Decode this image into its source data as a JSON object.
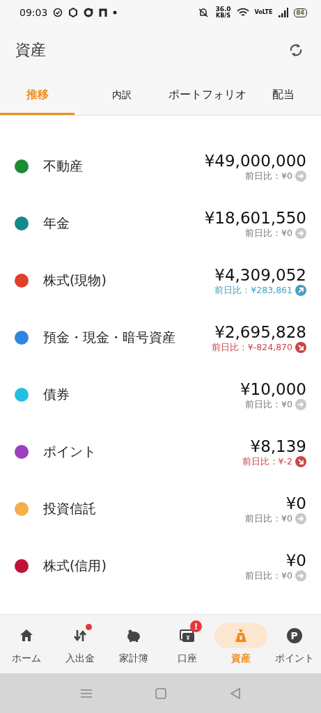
{
  "status_bar": {
    "time": "09:03",
    "speed": "36.0",
    "speed_unit": "KB/S",
    "network": "VoLTE",
    "battery": "84"
  },
  "app_bar": {
    "title": "資産"
  },
  "tabs": [
    {
      "label": "推移",
      "selected": true
    },
    {
      "label": "内訳",
      "selected": false
    },
    {
      "label": "ポートフォリオ",
      "selected": false
    },
    {
      "label": "配当",
      "selected": false
    }
  ],
  "assets": [
    {
      "name": "不動産",
      "color": "#1e8a32",
      "amount": "¥49,000,000",
      "change": "前日比：¥0",
      "kind": "flat"
    },
    {
      "name": "年金",
      "color": "#138a86",
      "amount": "¥18,601,550",
      "change": "前日比：¥0",
      "kind": "flat"
    },
    {
      "name": "株式(現物)",
      "color": "#e0402a",
      "amount": "¥4,309,052",
      "change": "前日比：¥283,861",
      "kind": "up"
    },
    {
      "name": "預金・現金・暗号資産",
      "color": "#2f86e0",
      "amount": "¥2,695,828",
      "change": "前日比：¥-824,870",
      "kind": "down"
    },
    {
      "name": "債券",
      "color": "#22c0dc",
      "amount": "¥10,000",
      "change": "前日比：¥0",
      "kind": "flat"
    },
    {
      "name": "ポイント",
      "color": "#9a3fc0",
      "amount": "¥8,139",
      "change": "前日比：¥-2",
      "kind": "down"
    },
    {
      "name": "投資信託",
      "color": "#f7ad4b",
      "amount": "¥0",
      "change": "前日比：¥0",
      "kind": "flat"
    },
    {
      "name": "株式(信用)",
      "color": "#c0103a",
      "amount": "¥0",
      "change": "前日比：¥0",
      "kind": "flat"
    }
  ],
  "bottom_nav": [
    {
      "label": "ホーム",
      "selected": false,
      "has_dot": false
    },
    {
      "label": "入出金",
      "selected": false,
      "has_dot": true
    },
    {
      "label": "家計簿",
      "selected": false,
      "has_dot": false
    },
    {
      "label": "口座",
      "selected": false,
      "has_dot": false,
      "badge_text": "!"
    },
    {
      "label": "資産",
      "selected": true,
      "has_dot": false
    },
    {
      "label": "ポイント",
      "selected": false,
      "has_dot": false,
      "icon_text": "P"
    }
  ]
}
